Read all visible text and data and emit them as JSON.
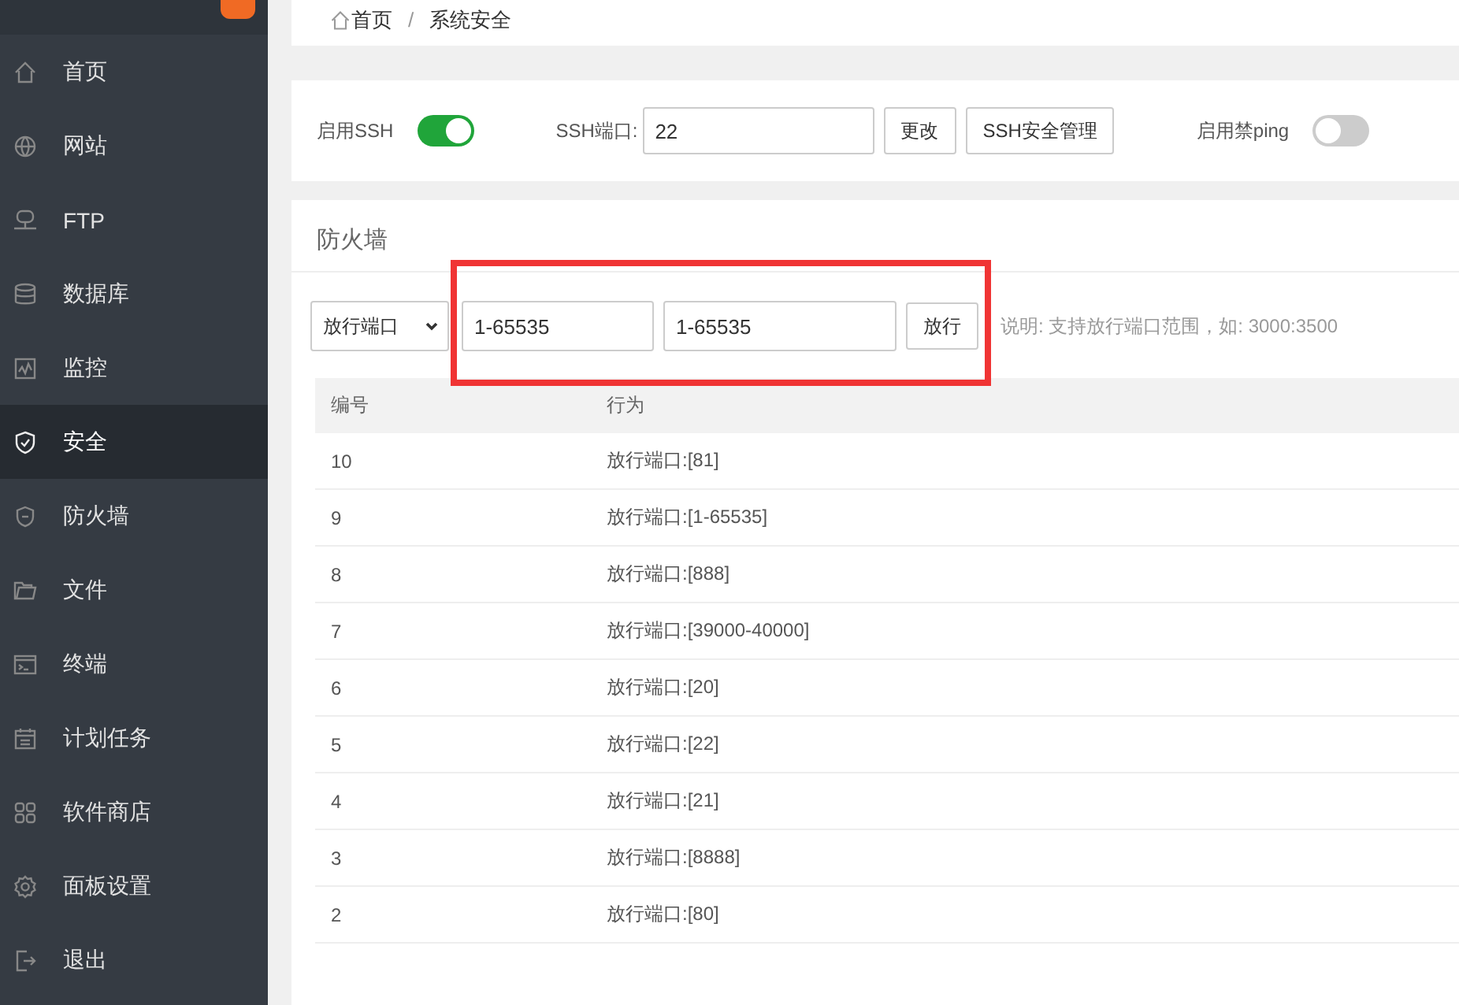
{
  "sidebar": {
    "items": [
      {
        "label": "首页",
        "selected": false
      },
      {
        "label": "网站",
        "selected": false
      },
      {
        "label": "FTP",
        "selected": false
      },
      {
        "label": "数据库",
        "selected": false
      },
      {
        "label": "监控",
        "selected": false
      },
      {
        "label": "安全",
        "selected": true
      },
      {
        "label": "防火墙",
        "selected": false
      },
      {
        "label": "文件",
        "selected": false
      },
      {
        "label": "终端",
        "selected": false
      },
      {
        "label": "计划任务",
        "selected": false
      },
      {
        "label": "软件商店",
        "selected": false
      },
      {
        "label": "面板设置",
        "selected": false
      },
      {
        "label": "退出",
        "selected": false
      }
    ]
  },
  "breadcrumb": {
    "items": [
      "首页",
      "系统安全"
    ],
    "separator": "/"
  },
  "ssh": {
    "enable_label": "启用SSH",
    "enabled": true,
    "port_label": "SSH端口:",
    "port": "22",
    "change_button": "更改",
    "manage_button": "SSH安全管理",
    "ping_label": "启用禁ping",
    "ping_disabled": false
  },
  "firewall": {
    "title": "防火墙",
    "mode": "放行端口",
    "port_from": "1-65535",
    "port_to": "1-65535",
    "allow_button": "放行",
    "note": "说明: 支持放行端口范围，如: 3000:3500",
    "table": {
      "columns": [
        "编号",
        "行为"
      ],
      "rows": [
        [
          "10",
          "放行端口:[81]"
        ],
        [
          "9",
          "放行端口:[1-65535]"
        ],
        [
          "8",
          "放行端口:[888]"
        ],
        [
          "7",
          "放行端口:[39000-40000]"
        ],
        [
          "6",
          "放行端口:[20]"
        ],
        [
          "5",
          "放行端口:[22]"
        ],
        [
          "4",
          "放行端口:[21]"
        ],
        [
          "3",
          "放行端口:[8888]"
        ],
        [
          "2",
          "放行端口:[80]"
        ]
      ]
    }
  }
}
